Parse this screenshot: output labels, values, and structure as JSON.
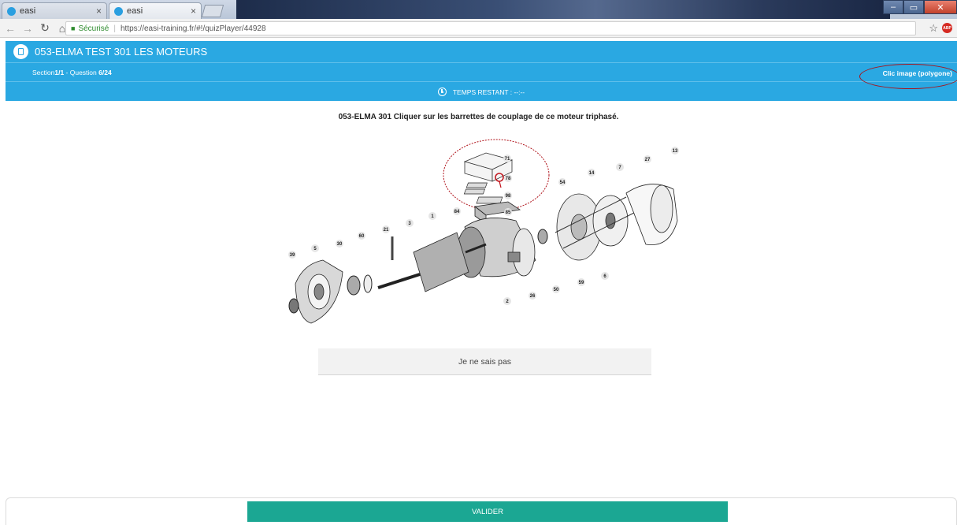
{
  "browser": {
    "tabs": [
      {
        "title": "easi",
        "active": false
      },
      {
        "title": "easi",
        "active": true
      }
    ],
    "tab_close_glyph": "×",
    "address": {
      "security_label": "Sécurisé",
      "url": "https://easi-training.fr/#!/quizPlayer/44928"
    },
    "icons": [
      "back-icon",
      "forward-icon",
      "reload-icon",
      "home-icon",
      "lock-icon",
      "star-icon",
      "adblock-icon"
    ],
    "adblock_label": "ABP"
  },
  "app": {
    "title": "053-ELMA TEST 301 LES MOTEURS",
    "section_prefix": "Section ",
    "section_value": "1/1",
    "question_prefix": " - Question ",
    "question_value": "6/24",
    "question_type": "Clic image (polygone)",
    "timer_label": "TEMPS RESTANT : --:--",
    "accent_color": "#2aa8e2",
    "validate_color": "#1ba793"
  },
  "main": {
    "question_text": "053-ELMA 301 Cliquer sur les barrettes de couplage de ce moteur triphasé.",
    "part_labels": [
      "71",
      "78",
      "98",
      "85",
      "84",
      "54",
      "14",
      "7",
      "27",
      "13",
      "1",
      "3",
      "21",
      "60",
      "30",
      "5",
      "39",
      "2",
      "26",
      "50",
      "59",
      "6"
    ],
    "dont_know_label": "Je ne sais pas",
    "validate_label": "VALIDER"
  }
}
